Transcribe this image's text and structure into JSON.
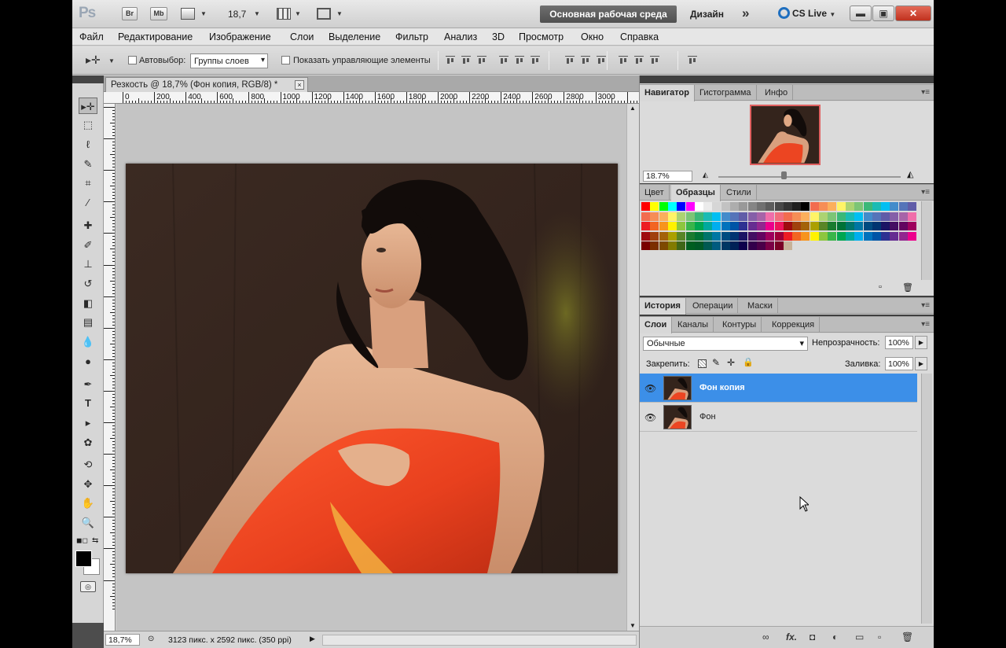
{
  "app": {
    "logo": "Ps",
    "buttons": [
      "Br",
      "Mb"
    ],
    "zoom": "18,7",
    "workspace_active": "Основная рабочая среда",
    "workspace_other": "Дизайн",
    "more": "»",
    "cslive": "CS Live"
  },
  "menu": [
    "Файл",
    "Редактирование",
    "Изображение",
    "Слои",
    "Выделение",
    "Фильтр",
    "Анализ",
    "3D",
    "Просмотр",
    "Окно",
    "Справка"
  ],
  "options": {
    "autoselect_label": "Автовыбор:",
    "autoselect_value": "Группы слоев",
    "show_controls_label": "Показать управляющие элементы"
  },
  "document": {
    "tab_title": "Резкость @ 18,7% (Фон копия, RGB/8) *",
    "close": "×",
    "ruler_labels": [
      "0",
      "200",
      "400",
      "600",
      "800",
      "1000",
      "1200",
      "1400",
      "1600",
      "1800",
      "2000",
      "2200",
      "2400",
      "2600",
      "2800",
      "3000"
    ],
    "status_zoom": "18,7%",
    "status_info": "3123 пикс. x 2592 пикс. (350 ppi)"
  },
  "panels": {
    "navigator_tabs": [
      "Навигатор",
      "Гистограмма",
      "Инфо"
    ],
    "navigator_zoom": "18.7%",
    "swatch_tabs": [
      "Цвет",
      "Образцы",
      "Стили"
    ],
    "history_tabs": [
      "История",
      "Операции",
      "Маски"
    ],
    "layers_tabs": [
      "Слои",
      "Каналы",
      "Контуры",
      "Коррекция"
    ],
    "blend_mode": "Обычные",
    "opacity_label": "Непрозрачность:",
    "opacity_value": "100%",
    "lock_label": "Закрепить:",
    "fill_label": "Заливка:",
    "fill_value": "100%",
    "layers": [
      {
        "name": "Фон копия",
        "selected": true
      },
      {
        "name": "Фон",
        "selected": false
      }
    ]
  },
  "colors": {
    "selected_layer": "#3c8fe8",
    "workspace_button": "#5a5a5a"
  },
  "icons": {
    "move_tool": "move-icon",
    "eye": "eye-icon",
    "cursor": "mouse-cursor"
  }
}
